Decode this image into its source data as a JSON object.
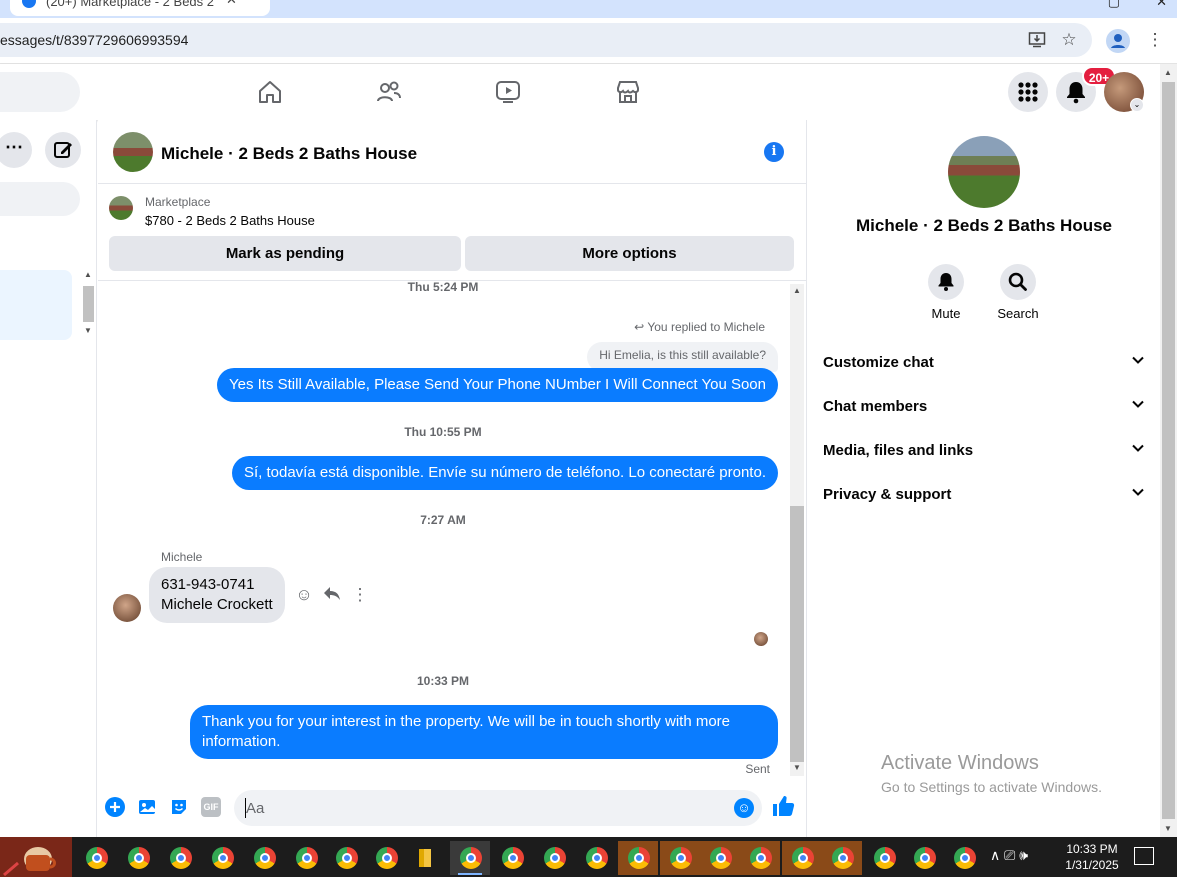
{
  "browser": {
    "tab_title": "(20+) Marketplace - 2 Beds 2 B...",
    "url": "essages/t/8397729606993594"
  },
  "fb_nav": {
    "notification_badge": "20+"
  },
  "conversation": {
    "title": "Michele · 2 Beds 2 Baths House",
    "marketplace": {
      "label": "Marketplace",
      "listing": "$780 - 2 Beds 2 Baths House",
      "mark_pending": "Mark as pending",
      "more_options": "More options"
    },
    "timestamps": {
      "t1": "Thu 5:24 PM",
      "t2": "Thu 10:55 PM",
      "t3": "7:27 AM",
      "t4": "10:33 PM"
    },
    "replied_note": "You replied to Michele",
    "reply_quote": "Hi Emelia, is this still available?",
    "msg_out_1": "Yes Its Still Available, Please Send Your Phone NUmber I Will Connect You Soon",
    "msg_out_2": "Sí, todavía está disponible. Envíe su número de teléfono. Lo conectaré pronto.",
    "sender_name": "Michele",
    "msg_in_line1": "631-943-0741",
    "msg_in_line2": "Michele Crockett",
    "msg_out_3_line1": "Thank you for your interest in the property. We will be in touch shortly with more",
    "msg_out_3_line2": "information.",
    "sent_label": "Sent",
    "composer_placeholder": "Aa",
    "gif_label": "GIF"
  },
  "details": {
    "name": "Michele · 2 Beds 2 Baths House",
    "mute_label": "Mute",
    "search_label": "Search",
    "sections": [
      "Customize chat",
      "Chat members",
      "Media, files and links",
      "Privacy & support"
    ]
  },
  "watermark": {
    "title": "Activate Windows",
    "subtitle": "Go to Settings to activate Windows."
  },
  "taskbar": {
    "time": "10:33 PM",
    "date": "1/31/2025"
  },
  "colors": {
    "accent": "#0a7cff",
    "fb_blue": "#1877f2",
    "badge_red": "#e41e3f"
  }
}
